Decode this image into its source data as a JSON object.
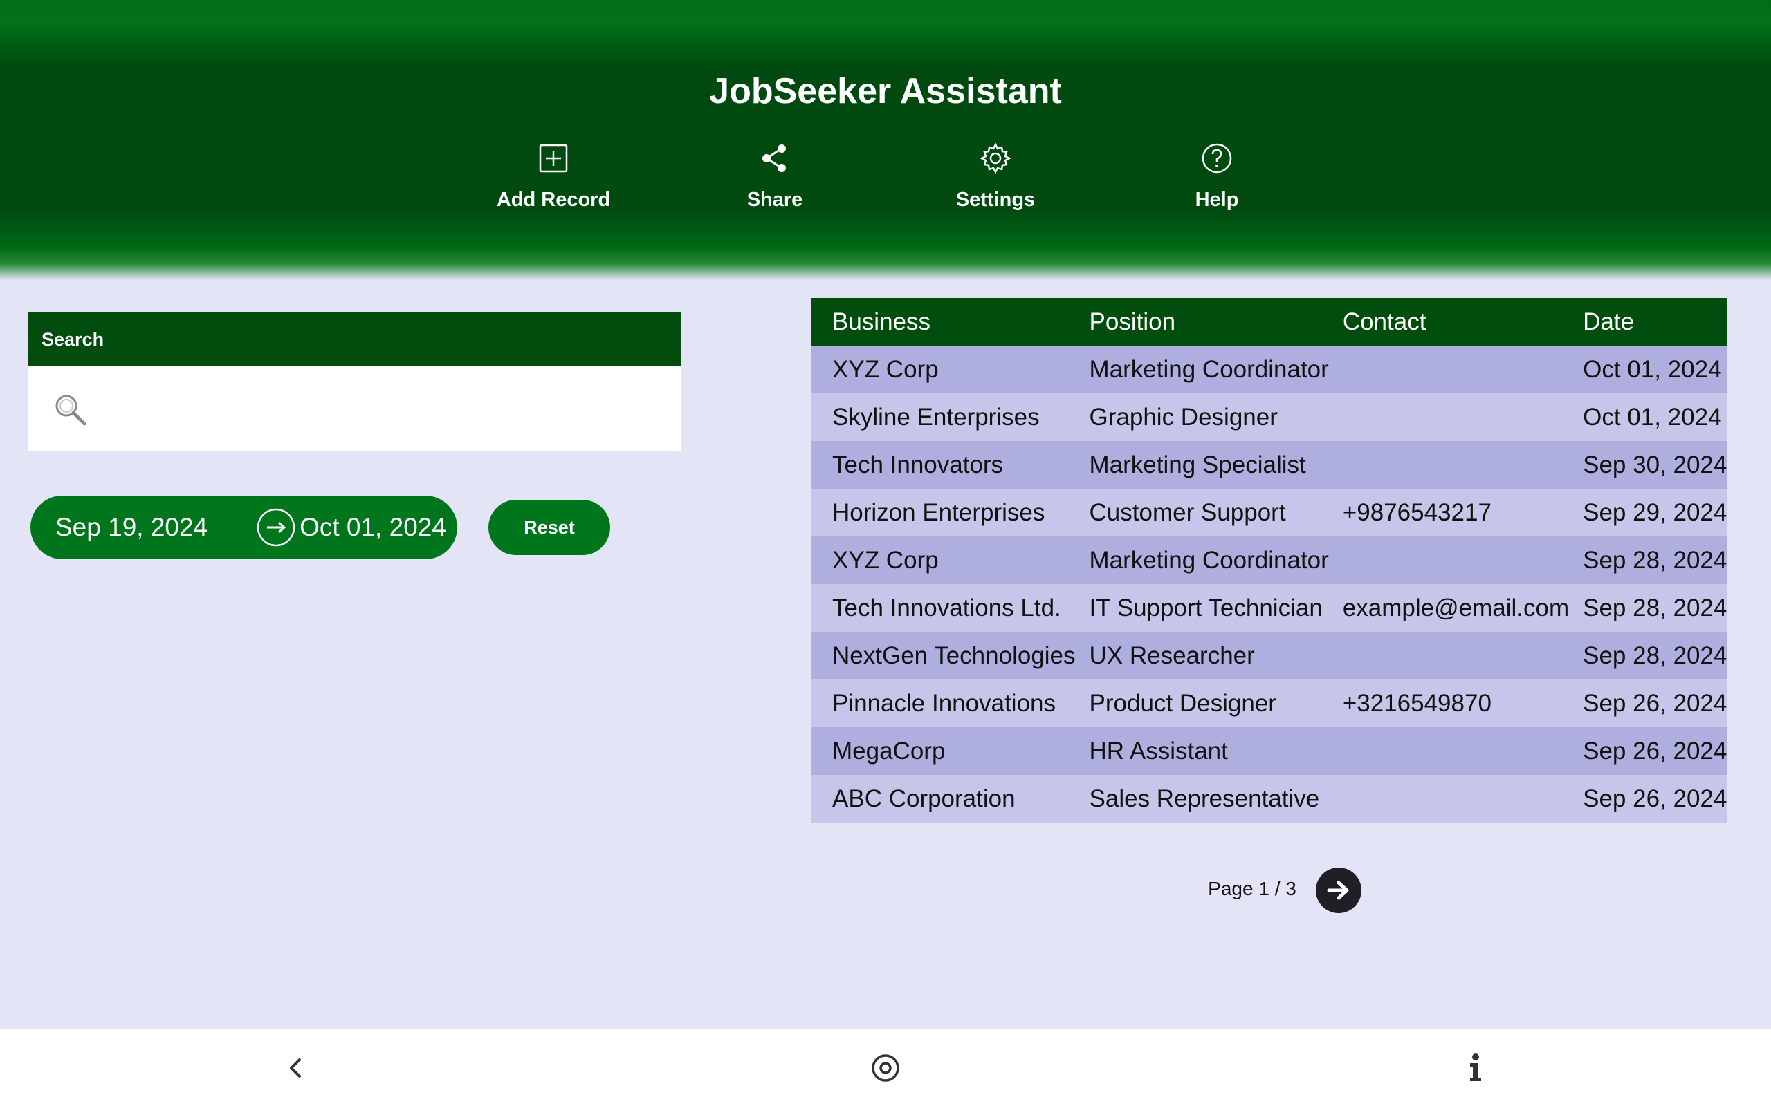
{
  "app": {
    "title": "JobSeeker Assistant"
  },
  "toolbar": {
    "add_record": {
      "label": "Add Record",
      "icon": "add-square-icon"
    },
    "share": {
      "label": "Share",
      "icon": "share-icon"
    },
    "settings": {
      "label": "Settings",
      "icon": "gear-icon"
    },
    "help": {
      "label": "Help",
      "icon": "question-circle-icon"
    }
  },
  "search": {
    "header": "Search",
    "value": "",
    "icon": "search-icon"
  },
  "date_filter": {
    "start": "Sep 19, 2024",
    "end": "Oct 01, 2024",
    "icon": "arrow-right-circle-icon",
    "reset_label": "Reset"
  },
  "table": {
    "columns": [
      "Business",
      "Position",
      "Contact",
      "Date"
    ],
    "rows": [
      [
        "XYZ Corp",
        "Marketing Coordinator",
        "",
        "Oct 01, 2024"
      ],
      [
        "Skyline Enterprises",
        "Graphic Designer",
        "",
        "Oct 01, 2024"
      ],
      [
        "Tech Innovators",
        "Marketing Specialist",
        "",
        "Sep 30, 2024"
      ],
      [
        "Horizon Enterprises",
        "Customer Support",
        "+9876543217",
        "Sep 29, 2024"
      ],
      [
        "XYZ Corp",
        "Marketing Coordinator",
        "",
        "Sep 28, 2024"
      ],
      [
        "Tech Innovations Ltd.",
        "IT Support Technician",
        "example@email.com",
        "Sep 28, 2024"
      ],
      [
        "NextGen Technologies",
        "UX Researcher",
        "",
        "Sep 28, 2024"
      ],
      [
        "Pinnacle Innovations",
        "Product Designer",
        "+3216549870",
        "Sep 26, 2024"
      ],
      [
        "MegaCorp",
        "HR Assistant",
        "",
        "Sep 26, 2024"
      ],
      [
        "ABC Corporation",
        "Sales Representative",
        "",
        "Sep 26, 2024"
      ]
    ]
  },
  "pagination": {
    "label": "Page 1 / 3",
    "next_icon": "arrow-right-icon"
  },
  "navbar": {
    "back_icon": "chevron-left-icon",
    "home_icon": "home-circle-icon",
    "info_icon": "info-icon"
  },
  "colors": {
    "header_dark": "#004a10",
    "accent_green": "#00761c",
    "row_odd": "#aeaedf",
    "row_even": "#c6c6ea",
    "background": "#e4e4f7"
  }
}
